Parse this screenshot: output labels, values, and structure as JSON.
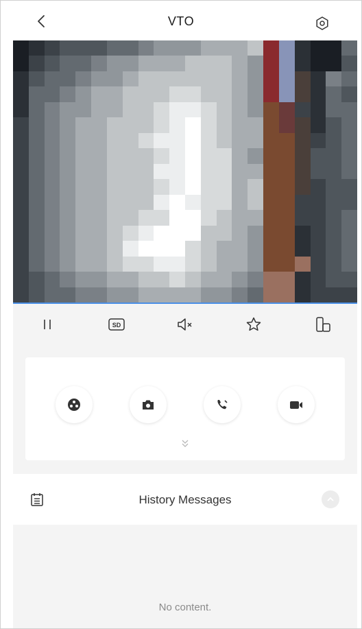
{
  "header": {
    "title": "VTO",
    "back_icon": "chevron-left-icon",
    "settings_icon": "gear-icon"
  },
  "video": {
    "columns": 22,
    "rows": 17,
    "palette": [
      "#1a1e24",
      "#2b3036",
      "#3c4248",
      "#4f565c",
      "#636a70",
      "#7a8086",
      "#90969b",
      "#a8adb1",
      "#c0c4c6",
      "#d7dadb",
      "#eceeef",
      "#ffffff",
      "#8a2a2e",
      "#6a3a3a",
      "#5a3a2a",
      "#3a4a6a",
      "#8894b8",
      "#7a4a30",
      "#4a3f3a",
      "#9a7060"
    ],
    "pixels": [
      "0123334456667778cg10043",
      "0234456677788876cg10032",
      "1344566788888876cgi1543",
      "1445677888998876cgi1432",
      "1456677889aa9876hdo1443",
      "2456778889ab9877hdi1343",
      "245677889aab9877hhi2343",
      "2456778889ab9976hhi3343",
      "245677888aab9977hhi3343",
      "2456778889ab9978hhi2332",
      "245677888aba9978hh22332",
      "2456778899bb9877hh22342",
      "24567789abbb8876hh12342",
      "2456778abbb98776hh12342",
      "245677899aa98776hhj2342",
      "2345667788987765jj12331",
      "2344556677776654jj12221"
    ]
  },
  "toolbar": {
    "items": [
      {
        "name": "pause-button",
        "icon": "pause-icon"
      },
      {
        "name": "sd-button",
        "icon": "sd-icon",
        "label": "SD"
      },
      {
        "name": "mute-button",
        "icon": "speaker-muted-icon"
      },
      {
        "name": "favorite-button",
        "icon": "star-icon"
      },
      {
        "name": "fullscreen-button",
        "icon": "rotate-screen-icon"
      }
    ]
  },
  "controls": {
    "buttons": [
      {
        "name": "unlock-button",
        "icon": "unlock-icon"
      },
      {
        "name": "snapshot-button",
        "icon": "camera-icon"
      },
      {
        "name": "talk-button",
        "icon": "phone-icon"
      },
      {
        "name": "record-button",
        "icon": "video-camera-icon"
      }
    ],
    "expand_icon": "double-chevron-down-icon"
  },
  "history": {
    "icon": "calendar-list-icon",
    "title": "History Messages",
    "collapse_icon": "chevron-up-icon",
    "empty_text": "No content."
  }
}
